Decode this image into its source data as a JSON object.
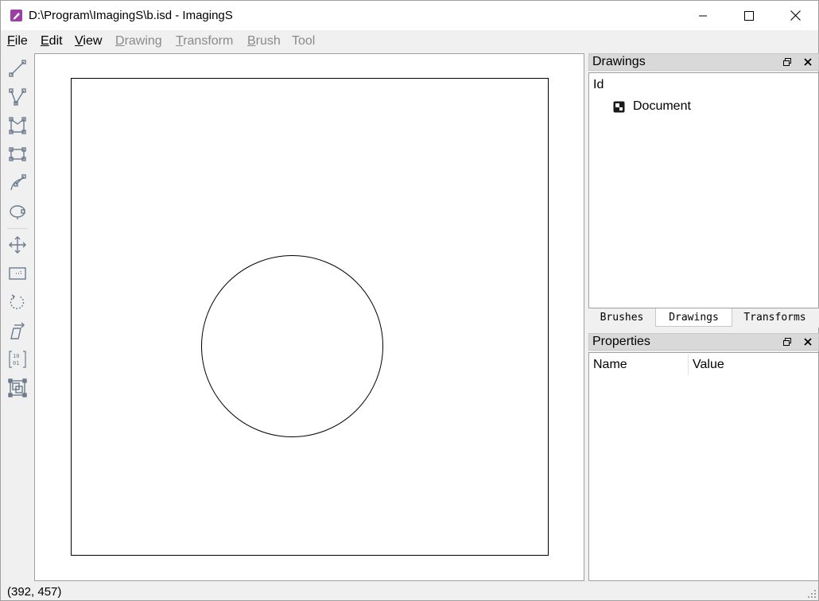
{
  "window": {
    "title": "D:\\Program\\ImagingS\\b.isd - ImagingS",
    "icon": "app-icon"
  },
  "menu": [
    {
      "label": "File",
      "accel": "F",
      "rest": "ile",
      "enabled": true
    },
    {
      "label": "Edit",
      "accel": "E",
      "rest": "dit",
      "enabled": true
    },
    {
      "label": "View",
      "accel": "V",
      "rest": "iew",
      "enabled": true
    },
    {
      "label": "Drawing",
      "accel": "D",
      "rest": "rawing",
      "enabled": false
    },
    {
      "label": "Transform",
      "accel": "T",
      "rest": "ransform",
      "enabled": false
    },
    {
      "label": "Brush",
      "accel": "B",
      "rest": "rush",
      "enabled": false
    },
    {
      "label": "Tool",
      "accel": "",
      "rest": "Tool",
      "enabled": false
    }
  ],
  "toolbar": {
    "tools": [
      "line-tool-icon",
      "polyline-tool-icon",
      "polygon-tool-icon",
      "rectangle-tool-icon",
      "curve-tool-icon",
      "ellipse-tool-icon",
      "move-tool-icon",
      "clip-tool-icon",
      "rotate-tool-icon",
      "skew-tool-icon",
      "matrix-tool-icon",
      "scale-tool-icon"
    ]
  },
  "drawings_panel": {
    "title": "Drawings",
    "column_header": "Id",
    "items": [
      {
        "label": "Document",
        "icon": "document-icon"
      }
    ]
  },
  "tabs": [
    {
      "label": "Brushes",
      "active": false
    },
    {
      "label": "Drawings",
      "active": true
    },
    {
      "label": "Transforms",
      "active": false
    }
  ],
  "properties_panel": {
    "title": "Properties",
    "columns": [
      "Name",
      "Value"
    ]
  },
  "status": {
    "coordinates": "(392, 457)"
  }
}
